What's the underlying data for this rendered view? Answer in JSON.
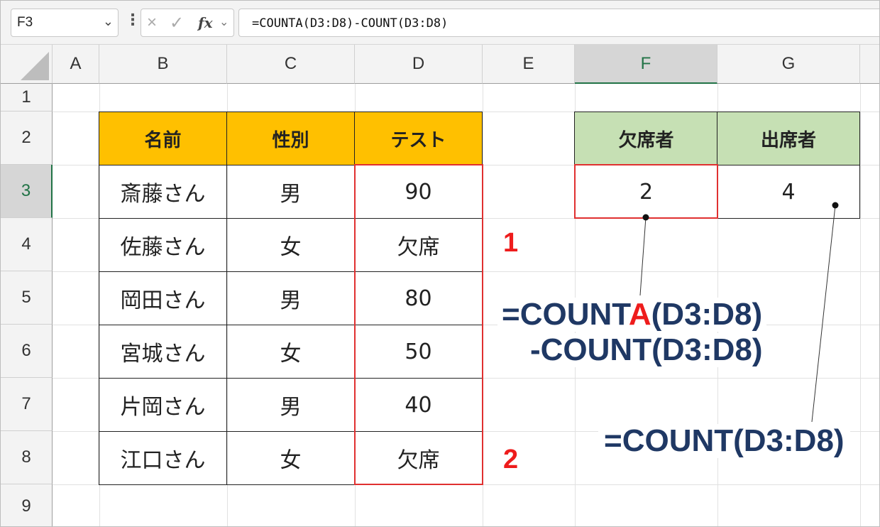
{
  "formula_bar": {
    "name_box": "F3",
    "formula": "=COUNTA(D3:D8)-COUNT(D3:D8)",
    "fx_label": "fx",
    "cancel_icon": "×",
    "enter_icon": "✓"
  },
  "columns": [
    "A",
    "B",
    "C",
    "D",
    "E",
    "F",
    "G"
  ],
  "rows": [
    "1",
    "2",
    "3",
    "4",
    "5",
    "6",
    "7",
    "8",
    "9"
  ],
  "selected_cell": "F3",
  "table1": {
    "headers": [
      "名前",
      "性別",
      "テスト"
    ],
    "rows": [
      [
        "斎藤さん",
        "男",
        "90"
      ],
      [
        "佐藤さん",
        "女",
        "欠席"
      ],
      [
        "岡田さん",
        "男",
        "80"
      ],
      [
        "宮城さん",
        "女",
        "50"
      ],
      [
        "片岡さん",
        "男",
        "40"
      ],
      [
        "江口さん",
        "女",
        "欠席"
      ]
    ],
    "header_color": "#ffc000"
  },
  "table2": {
    "headers": [
      "欠席者",
      "出席者"
    ],
    "values": [
      "2",
      "4"
    ],
    "header_color": "#c6e0b4"
  },
  "annotations": {
    "marker_1": "1",
    "marker_2": "2",
    "formula_a_part1": "=COUNT",
    "formula_a_highlight": "A",
    "formula_a_part2": "(D3:D8)",
    "formula_a_line2": "-COUNT(D3:D8)",
    "formula_b": "=COUNT(D3:D8)"
  },
  "colors": {
    "accent_green": "#217346",
    "highlight_red": "#e03030",
    "formula_navy": "#1f3864"
  }
}
